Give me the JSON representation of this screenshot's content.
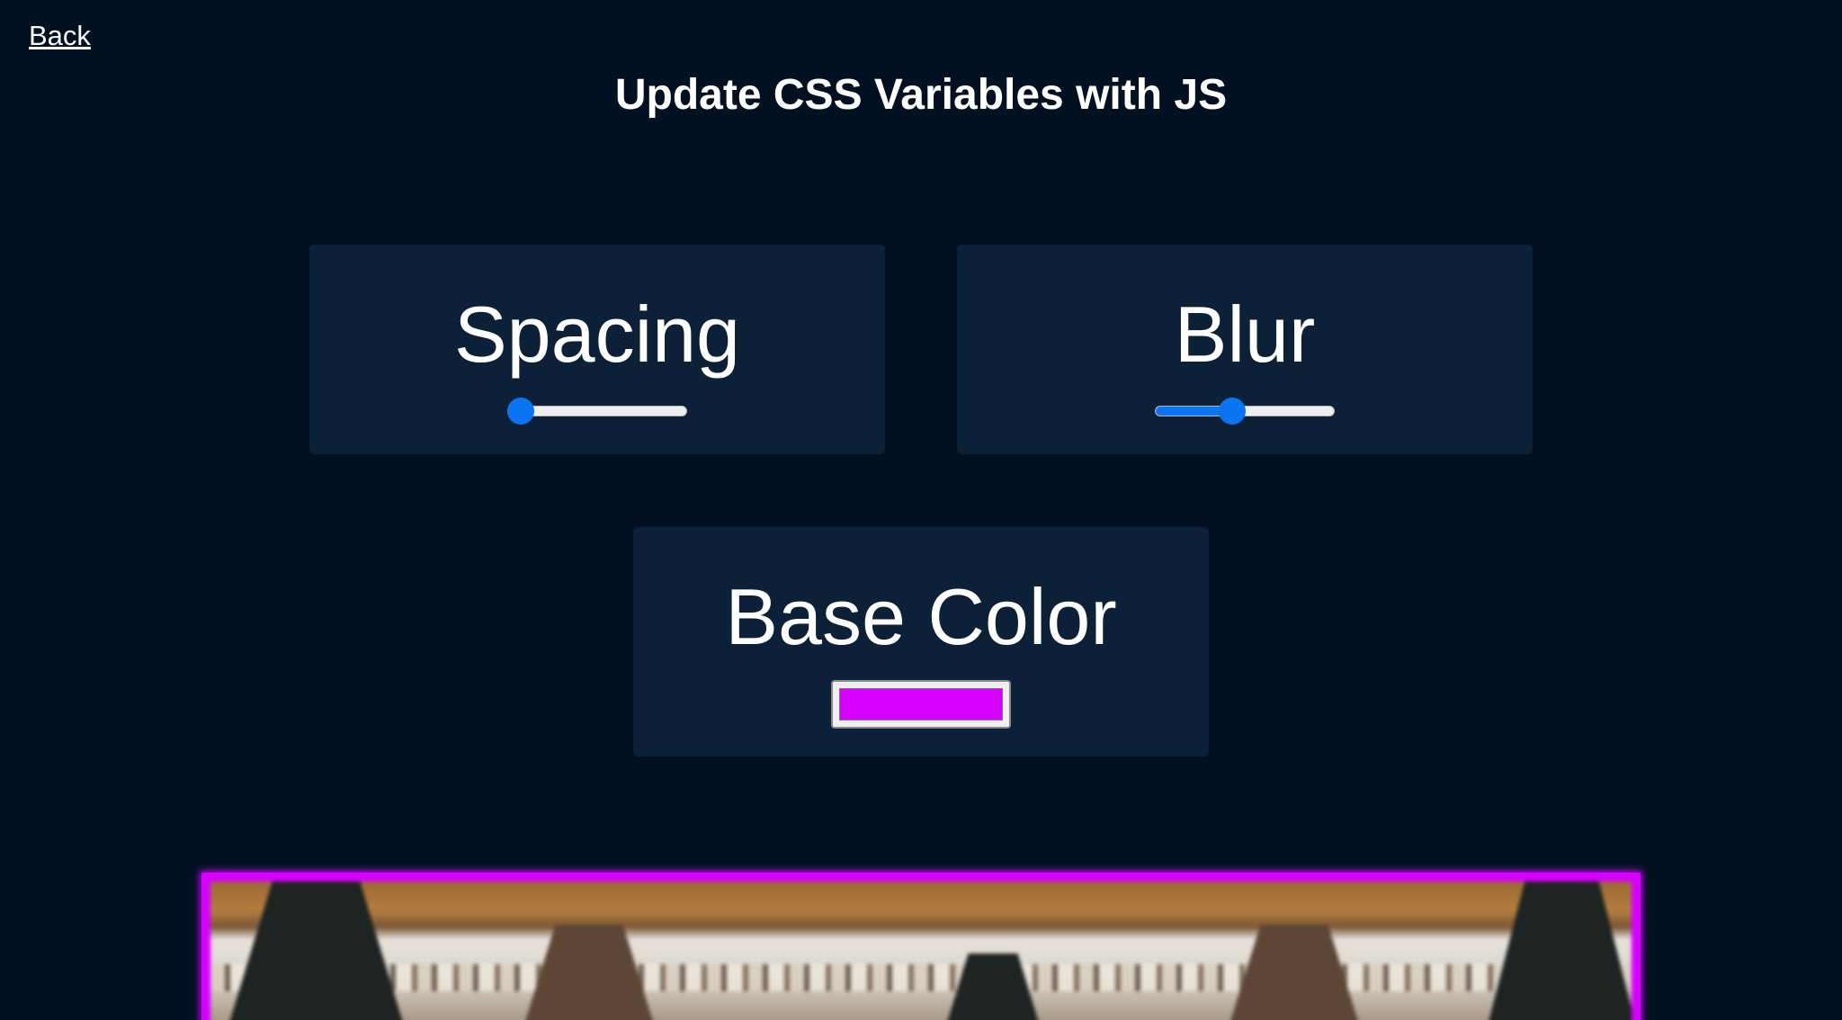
{
  "nav": {
    "back_label": "Back"
  },
  "page": {
    "title": "Update CSS Variables with JS"
  },
  "controls": {
    "spacing": {
      "label": "Spacing",
      "value_fraction": 0.0
    },
    "blur": {
      "label": "Blur",
      "value_fraction": 0.42
    },
    "base_color": {
      "label": "Base Color",
      "value": "#d600ff"
    }
  },
  "colors": {
    "page_background": "#011122",
    "card_background": "#0c2137",
    "slider_accent": "#0b74f0",
    "frame_glow": "#d600ff"
  },
  "image": {
    "icon": "photo-image"
  }
}
